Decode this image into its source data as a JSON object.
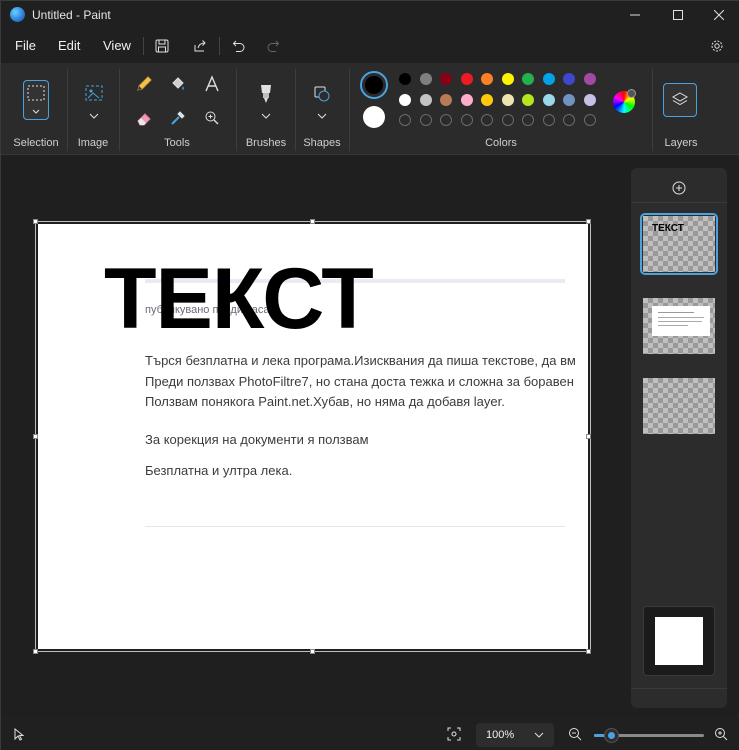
{
  "window": {
    "title": "Untitled - Paint",
    "icon": "paint-app-icon",
    "controls": [
      "minimize-icon",
      "maximize-icon",
      "close-icon"
    ]
  },
  "menu": {
    "file": "File",
    "edit": "Edit",
    "view": "View",
    "quick_actions": [
      "save-icon",
      "share-icon",
      "undo-icon",
      "redo-icon"
    ],
    "settings_icon": "gear-icon"
  },
  "ribbon": {
    "groups": {
      "selection": "Selection",
      "image": "Image",
      "tools": "Tools",
      "brushes": "Brushes",
      "shapes": "Shapes",
      "colors": "Colors",
      "layers": "Layers"
    },
    "tools": [
      "pencil-icon",
      "fill-icon",
      "text-icon",
      "eraser-icon",
      "color-picker-icon",
      "magnifier-icon"
    ],
    "colors": {
      "primary": "#000000",
      "secondary": "#ffffff",
      "row1": [
        "#000000",
        "#7f7f7f",
        "#880015",
        "#ed1c24",
        "#ff7f27",
        "#fff200",
        "#22b14c",
        "#00a2e8",
        "#3f48cc",
        "#a349a4"
      ],
      "row2": [
        "#ffffff",
        "#c3c3c3",
        "#b97a57",
        "#ffaec9",
        "#ffc90e",
        "#efe4b0",
        "#b5e61d",
        "#99d9ea",
        "#7092be",
        "#c8bfe7"
      ],
      "accent": "#4aa3df"
    }
  },
  "canvas": {
    "big_text": "ТЕКСТ",
    "meta_text": "публикувано преди часа",
    "lines": [
      "Търся безплатна и лека програма.Изисквания да пиша текстове, да вм",
      "Преди ползвах PhotoFiltre7, но стана доста тежка и сложна за боравен",
      "Ползвам понякога Paint.net.Хубав, но няма да добавя layer.",
      "За корекция на документи я ползвам",
      "Безплатна и ултра лека."
    ]
  },
  "layers_panel": {
    "add_icon": "add-layer-icon",
    "layer1_label": "ТЕКСТ"
  },
  "status": {
    "zoom": "100%",
    "zoom_level": 0.1
  }
}
